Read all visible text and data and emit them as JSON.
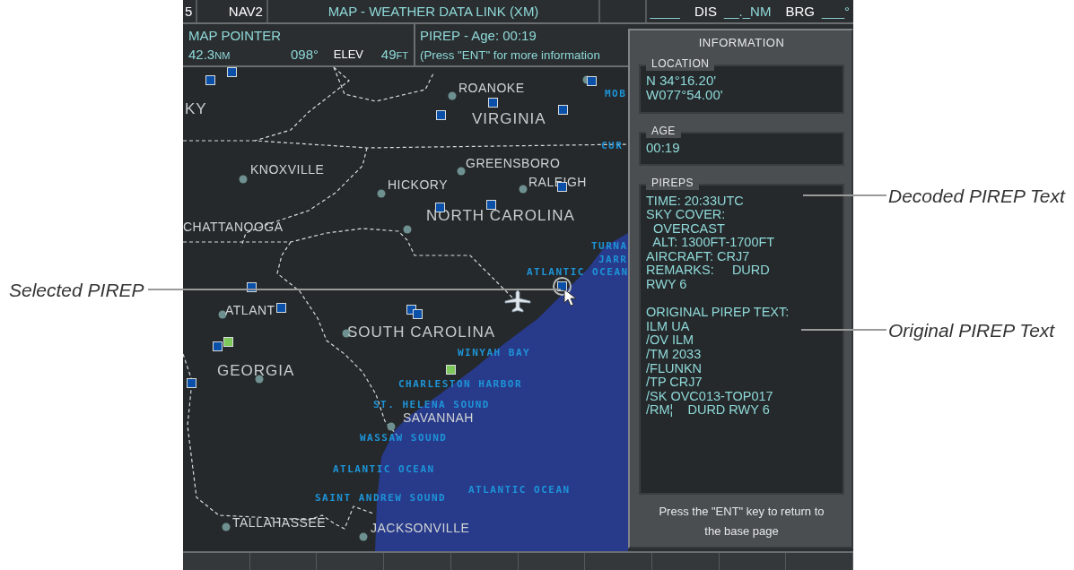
{
  "top_bar": {
    "field_1": "5",
    "field_2": "NAV2",
    "title": "MAP - WEATHER DATA LINK (XM)",
    "waypoint": "____",
    "dis_label": "DIS",
    "dis_value": "__._NM",
    "brg_label": "BRG",
    "brg_value": "___°"
  },
  "map_pointer": {
    "title": "MAP POINTER",
    "distance": "42.3",
    "distance_unit": "NM",
    "bearing": "098°",
    "elev_label": "ELEV",
    "elev_value": "49",
    "elev_unit": "FT"
  },
  "pirep_bar": {
    "title": "PIREP - Age: 00:19",
    "hint": "(Press \"ENT\" for more information"
  },
  "map": {
    "labels": [
      {
        "text": "KY",
        "kind": "region"
      },
      {
        "text": "ROANOKE",
        "kind": "city"
      },
      {
        "text": "VIRGINIA",
        "kind": "region"
      },
      {
        "text": "KNOXVILLE",
        "kind": "city"
      },
      {
        "text": "GREENSBORO",
        "kind": "city"
      },
      {
        "text": "HICKORY",
        "kind": "city"
      },
      {
        "text": "RALEIGH",
        "kind": "city"
      },
      {
        "text": "NORTH CAROLINA",
        "kind": "region"
      },
      {
        "text": "CHATTANOOGA",
        "kind": "city"
      },
      {
        "text": "ATLANT",
        "kind": "city"
      },
      {
        "text": "SOUTH CAROLINA",
        "kind": "region"
      },
      {
        "text": "GEORGIA",
        "kind": "region"
      },
      {
        "text": "SAVANNAH",
        "kind": "city"
      },
      {
        "text": "TALLAHASSEE",
        "kind": "city"
      },
      {
        "text": "JACKSONVILLE",
        "kind": "city"
      },
      {
        "text": "MOB",
        "kind": "water"
      },
      {
        "text": "CUR",
        "kind": "water"
      },
      {
        "text": "TURNA",
        "kind": "water"
      },
      {
        "text": "JARR",
        "kind": "water"
      },
      {
        "text": "ATLANTIC OCEAN",
        "kind": "water"
      },
      {
        "text": "WINYAH BAY",
        "kind": "water"
      },
      {
        "text": "CHARLESTON HARBOR",
        "kind": "water"
      },
      {
        "text": "ST. HELENA SOUND",
        "kind": "water"
      },
      {
        "text": "WASSAW SOUND",
        "kind": "water"
      },
      {
        "text": "ATLANTIC OCEAN",
        "kind": "water"
      },
      {
        "text": "ATLANTIC OCEAN",
        "kind": "water"
      },
      {
        "text": "SAINT ANDREW SOUND",
        "kind": "water"
      }
    ],
    "markers": [
      {
        "color": "#0a4fa8",
        "selected": false
      },
      {
        "color": "#0a4fa8",
        "selected": false
      },
      {
        "color": "#0a4fa8",
        "selected": false
      },
      {
        "color": "#0a4fa8",
        "selected": false
      },
      {
        "color": "#0a4fa8",
        "selected": false
      },
      {
        "color": "#0a4fa8",
        "selected": false
      },
      {
        "color": "#0a4fa8",
        "selected": false
      },
      {
        "color": "#0a4fa8",
        "selected": false
      },
      {
        "color": "#0a4fa8",
        "selected": false
      },
      {
        "color": "#0a4fa8",
        "selected": false
      },
      {
        "color": "#0a4fa8",
        "selected": false
      },
      {
        "color": "#0a4fa8",
        "selected": false
      },
      {
        "color": "#0a4fa8",
        "selected": false
      },
      {
        "color": "#0a4fa8",
        "selected": false
      },
      {
        "color": "#0a4fa8",
        "selected": false
      },
      {
        "color": "#7cc85a",
        "selected": false
      },
      {
        "color": "#7cc85a",
        "selected": false
      },
      {
        "color": "#0a4fa8",
        "selected": true
      }
    ]
  },
  "info_panel": {
    "title": "INFORMATION",
    "location": {
      "label": "LOCATION",
      "lines": [
        "N 34°16.20'",
        "W077°54.00'"
      ]
    },
    "age": {
      "label": "AGE",
      "value": "00:19"
    },
    "pireps": {
      "label": "PIREPS",
      "decoded_lines": [
        "TIME: 20:33UTC",
        "SKY COVER:",
        "  OVERCAST",
        "  ALT: 1300FT-1700FT",
        "AIRCRAFT: CRJ7",
        "REMARKS:     DURD",
        "RWY 6"
      ],
      "original_lines": [
        "ORIGINAL PIREP TEXT:",
        "ILM UA",
        "/OV ILM",
        "/TM 2033",
        "/FLUNKN",
        "/TP CRJ7",
        "/SK OVC013-TOP017",
        "/RM¦    DURD RWY 6"
      ]
    },
    "footer": "Press the \"ENT\" key to return to the base page"
  },
  "callouts": [
    {
      "text": "Selected PIREP"
    },
    {
      "text": "Decoded PIREP Text"
    },
    {
      "text": "Original PIREP Text"
    }
  ]
}
